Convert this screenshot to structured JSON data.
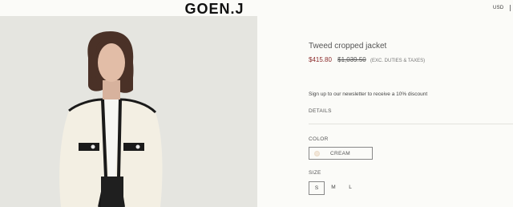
{
  "header": {
    "logo": "GOEN.J",
    "currency": "USD"
  },
  "product": {
    "title": "Tweed cropped jacket",
    "price_sale": "$415.80",
    "price_original": "$1,039.50",
    "price_note": "(EXC. DUTIES & TAXES)",
    "newsletter_text": "Sign up to our newsletter to receive a 10% discount",
    "details_label": "DETAILS",
    "color_label": "COLOR",
    "colors": [
      {
        "label": "CREAM",
        "swatch": "#f2e6d8",
        "selected": true
      }
    ],
    "size_label": "SIZE",
    "sizes": [
      {
        "label": "S",
        "selected": true
      },
      {
        "label": "M",
        "selected": false
      },
      {
        "label": "L",
        "selected": false
      }
    ]
  },
  "colors": {
    "sale_price": "#8b2b2b",
    "background": "#fbfbf8",
    "jacket": "#f3efe3",
    "trim": "#1a1a1a"
  }
}
